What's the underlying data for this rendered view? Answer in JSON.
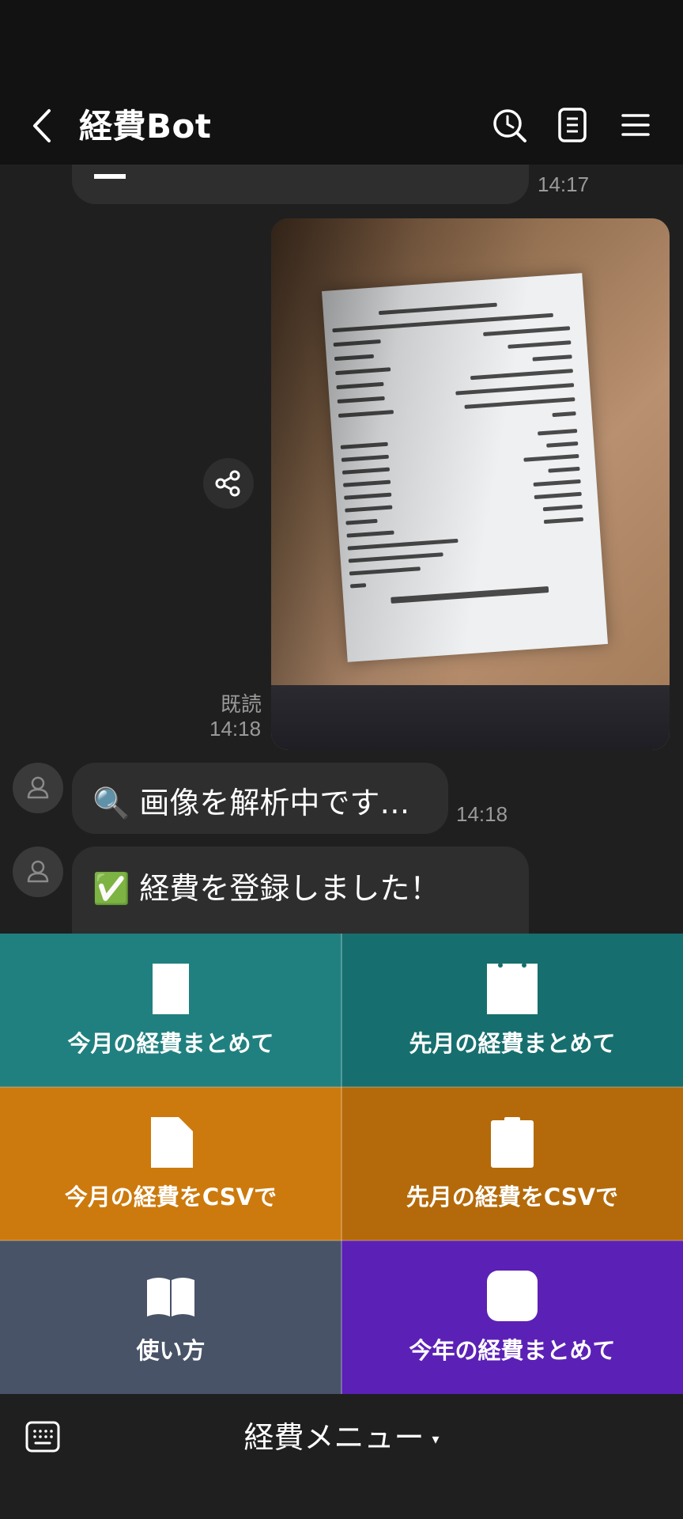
{
  "header": {
    "title": "経費Bot",
    "icons": [
      "back-icon",
      "history-search-icon",
      "notes-icon",
      "menu-icon"
    ]
  },
  "messages": {
    "prev_time": "14:17",
    "photo_read": "既読",
    "photo_time": "14:18",
    "analyzing_text": "🔍 画像を解析中です…",
    "analyzing_time": "14:18",
    "registered_text": "✅ 経費を登録しました！"
  },
  "richmenu": {
    "tiles": [
      {
        "label": "今月の経費まとめて",
        "color": "#20807f",
        "icon": "document-icon"
      },
      {
        "label": "先月の経費まとめて",
        "color": "#166f6e",
        "icon": "calendar-icon"
      },
      {
        "label": "今月の経費をCSVで",
        "color": "#cc7a0d",
        "icon": "file-icon"
      },
      {
        "label": "先月の経費をCSVで",
        "color": "#b46a0a",
        "icon": "clipboard-icon"
      },
      {
        "label": "使い方",
        "color": "#485367",
        "icon": "book-icon"
      },
      {
        "label": "今年の経費まとめて",
        "color": "#5b21b6",
        "icon": "square-icon"
      }
    ]
  },
  "bottombar": {
    "menu_label": "経費メニュー",
    "caret": "▾"
  }
}
